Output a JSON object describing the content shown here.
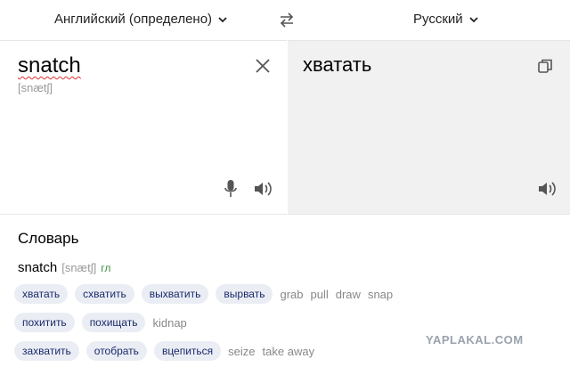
{
  "header": {
    "source_lang": "Английский (определено)",
    "target_lang": "Русский"
  },
  "source": {
    "text": "snatch",
    "transcription": "[snætʃ]"
  },
  "target": {
    "text": "хватать"
  },
  "dictionary": {
    "title": "Словарь",
    "entry": {
      "word": "snatch",
      "transcription": "[snætʃ]",
      "pos": "гл"
    },
    "rows": [
      {
        "chips": [
          "хватать",
          "схватить",
          "выхватить",
          "вырвать"
        ],
        "plain": [
          "grab",
          "pull",
          "draw",
          "snap"
        ]
      },
      {
        "chips": [
          "похитить",
          "похищать"
        ],
        "plain": [
          "kidnap"
        ]
      },
      {
        "chips": [
          "захватить",
          "отобрать",
          "вцепиться"
        ],
        "plain": [
          "seize",
          "take away"
        ]
      }
    ]
  },
  "watermark": "YAPLAKAL.COM"
}
